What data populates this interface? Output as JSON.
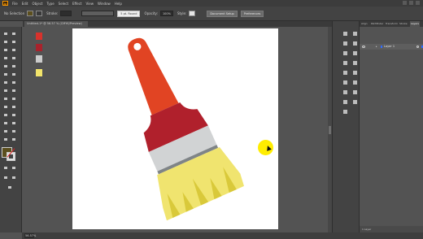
{
  "app": {
    "logo": "Ai"
  },
  "menu": [
    "File",
    "Edit",
    "Object",
    "Type",
    "Select",
    "Effect",
    "View",
    "Window",
    "Help"
  ],
  "control_bar": {
    "selection_label": "No Selection",
    "stroke_label": "Stroke:",
    "brush_value": "5 pt. Round",
    "opacity_label": "Opacity:",
    "opacity_value": "100%",
    "style_label": "Style:",
    "document_setup": "Document Setup",
    "preferences": "Preferences"
  },
  "document": {
    "tab_title": "Untitled-1* @ 56.57 % (CMYK/Preview)",
    "zoom_value": "56.57%"
  },
  "swatches": [
    "#d7322c",
    "#a8222c",
    "#cccccc",
    "#f2e46b"
  ],
  "illustration": {
    "handle_color": "#e14423",
    "ferrule_color": "#b0202c",
    "band_color": "#d1d3d4",
    "band_shadow": "#7f8487",
    "bristle_color": "#f0e46f",
    "bristle_shadow": "#d9c93a"
  },
  "cursor": {
    "highlight_color": "#ffed00"
  },
  "panels": {
    "tabs": [
      "Align",
      "Pathfinder",
      "Transform",
      "Stroke",
      "Layers"
    ],
    "active_tab": "Layers",
    "layer_name": "Layer 1",
    "footer": "1 Layer"
  }
}
